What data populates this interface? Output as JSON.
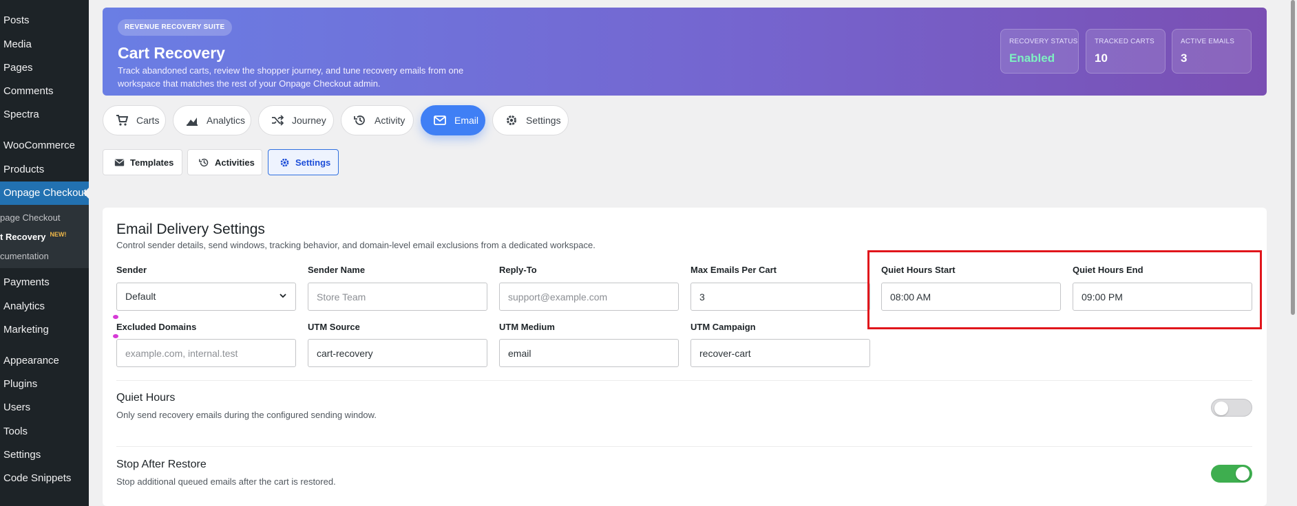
{
  "sidebar": {
    "items": [
      {
        "label": "Posts"
      },
      {
        "label": "Media"
      },
      {
        "label": "Pages"
      },
      {
        "label": "Comments"
      },
      {
        "label": "Spectra"
      },
      {
        "label": "WooCommerce"
      },
      {
        "label": "Products"
      },
      {
        "label": "Onpage Checkout"
      },
      {
        "label": "Payments"
      },
      {
        "label": "Analytics"
      },
      {
        "label": "Marketing"
      },
      {
        "label": "Appearance"
      },
      {
        "label": "Plugins"
      },
      {
        "label": "Users"
      },
      {
        "label": "Tools"
      },
      {
        "label": "Settings"
      },
      {
        "label": "Code Snippets"
      }
    ],
    "submenu": [
      {
        "label": "page Checkout"
      },
      {
        "label": "t Recovery",
        "badge": "NEW!"
      },
      {
        "label": "cumentation"
      }
    ]
  },
  "hero": {
    "chip": "REVENUE RECOVERY SUITE",
    "title": "Cart Recovery",
    "description": "Track abandoned carts, review the shopper journey, and tune recovery emails from one workspace that matches the rest of your Onpage Checkout admin.",
    "stats": [
      {
        "label": "RECOVERY STATUS",
        "value": "Enabled",
        "color": "#7ef0c2"
      },
      {
        "label": "TRACKED CARTS",
        "value": "10"
      },
      {
        "label": "ACTIVE EMAILS",
        "value": "3"
      }
    ]
  },
  "tabs": [
    {
      "label": "Carts",
      "icon": "cart-icon"
    },
    {
      "label": "Analytics",
      "icon": "chart-icon"
    },
    {
      "label": "Journey",
      "icon": "shuffle-icon"
    },
    {
      "label": "Activity",
      "icon": "history-icon"
    },
    {
      "label": "Email",
      "icon": "mail-icon",
      "active": true
    },
    {
      "label": "Settings",
      "icon": "gear-icon"
    }
  ],
  "subtabs": [
    {
      "label": "Templates",
      "icon": "mail-icon"
    },
    {
      "label": "Activities",
      "icon": "history-icon"
    },
    {
      "label": "Settings",
      "icon": "gear-icon",
      "active": true
    }
  ],
  "card": {
    "title": "Email Delivery Settings",
    "description": "Control sender details, send windows, tracking behavior, and domain-level email exclusions from a dedicated workspace.",
    "fields": {
      "sender": {
        "label": "Sender",
        "value": "Default"
      },
      "sender_name": {
        "label": "Sender Name",
        "placeholder": "Store Team"
      },
      "reply_to": {
        "label": "Reply-To",
        "placeholder": "support@example.com"
      },
      "max_emails": {
        "label": "Max Emails Per Cart",
        "value": "3"
      },
      "quiet_start": {
        "label": "Quiet Hours Start",
        "value": "08:00 AM"
      },
      "quiet_end": {
        "label": "Quiet Hours End",
        "value": "09:00 PM"
      },
      "excluded_domains": {
        "label": "Excluded Domains",
        "placeholder": "example.com, internal.test"
      },
      "utm_source": {
        "label": "UTM Source",
        "value": "cart-recovery"
      },
      "utm_medium": {
        "label": "UTM Medium",
        "value": "email"
      },
      "utm_campaign": {
        "label": "UTM Campaign",
        "value": "recover-cart"
      }
    },
    "toggles": [
      {
        "title": "Quiet Hours",
        "description": "Only send recovery emails during the configured sending window.",
        "on": false
      },
      {
        "title": "Stop After Restore",
        "description": "Stop additional queued emails after the cart is restored.",
        "on": true
      }
    ]
  },
  "colors": {
    "accent": "#3f7ff5",
    "toggle_on": "#3eae4f",
    "highlight": "#e0151b",
    "sidebar_bg": "#1d2327"
  }
}
